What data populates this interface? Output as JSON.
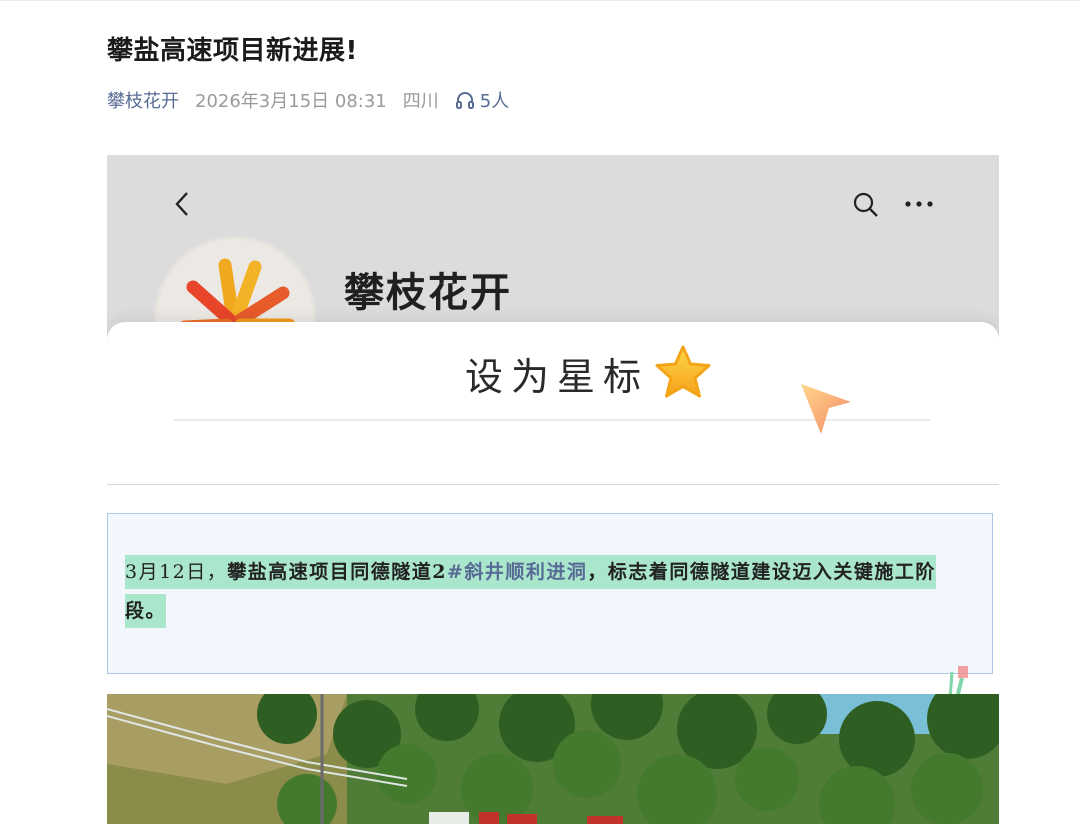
{
  "article": {
    "title": "攀盐高速项目新进展!",
    "account": "攀枝花开",
    "date": "2026年3月15日 08:31",
    "location": "四川",
    "listeners": "5人"
  },
  "embedded_screen": {
    "account_name": "攀枝花开",
    "star_prompt": "设为星标"
  },
  "paragraph": {
    "date_prefix": "3月12日，",
    "part1": "攀盐高速项目同德隧道2",
    "link_text": "#斜井顺利进洞",
    "part2": "，标志着同德隧道建设迈入关键施工阶",
    "part3": "段。"
  },
  "colors": {
    "link": "#576b95",
    "highlight": "#a9e6cc",
    "box_border": "#a9c8ea"
  }
}
